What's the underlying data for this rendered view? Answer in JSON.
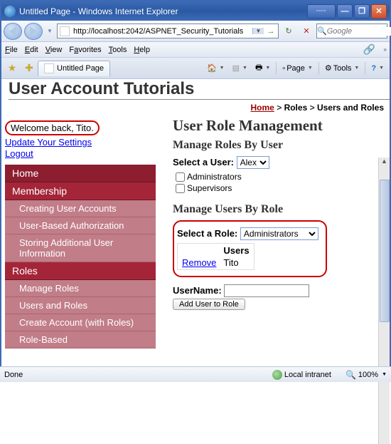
{
  "window": {
    "title": "Untitled Page - Windows Internet Explorer",
    "url": "http://localhost:2042/ASPNET_Security_Tutorials",
    "search_placeholder": "Google",
    "tab_title": "Untitled Page"
  },
  "menus": [
    "File",
    "Edit",
    "View",
    "Favorites",
    "Tools",
    "Help"
  ],
  "toolbar": {
    "home": "",
    "feed": "",
    "print": "Print",
    "page": "Page",
    "tools": "Tools"
  },
  "page": {
    "heading": "User Account Tutorials",
    "breadcrumb": {
      "home": "Home",
      "sep": ">",
      "roles": "Roles",
      "current": "Users and Roles"
    }
  },
  "welcome": {
    "text": "Welcome back, Tito.",
    "update": "Update Your Settings",
    "logout": "Logout"
  },
  "nav": {
    "items": [
      {
        "label": "Home",
        "type": "top"
      },
      {
        "label": "Membership",
        "type": "top-sel"
      },
      {
        "label": "Creating User Accounts",
        "type": "sub"
      },
      {
        "label": "User-Based Authorization",
        "type": "sub"
      },
      {
        "label": "Storing Additional User Information",
        "type": "sub"
      },
      {
        "label": "Roles",
        "type": "top-sel"
      },
      {
        "label": "Manage Roles",
        "type": "sub"
      },
      {
        "label": "Users and Roles",
        "type": "sub"
      },
      {
        "label": "Create Account (with Roles)",
        "type": "sub"
      },
      {
        "label": "Role-Based",
        "type": "sub"
      }
    ]
  },
  "main": {
    "title": "User Role Management",
    "byuser_title": "Manage Roles By User",
    "select_user_label": "Select a User:",
    "select_user_value": "Alex",
    "checkboxes": [
      "Administrators",
      "Supervisors"
    ],
    "byrole_title": "Manage Users By Role",
    "select_role_label": "Select a Role:",
    "select_role_value": "Administrators",
    "users_header": "Users",
    "remove_label": "Remove",
    "user_in_role": "Tito",
    "username_label": "UserName:",
    "add_button": "Add User to Role"
  },
  "status": {
    "left": "Done",
    "zone": "Local intranet",
    "zoom": "100%"
  }
}
